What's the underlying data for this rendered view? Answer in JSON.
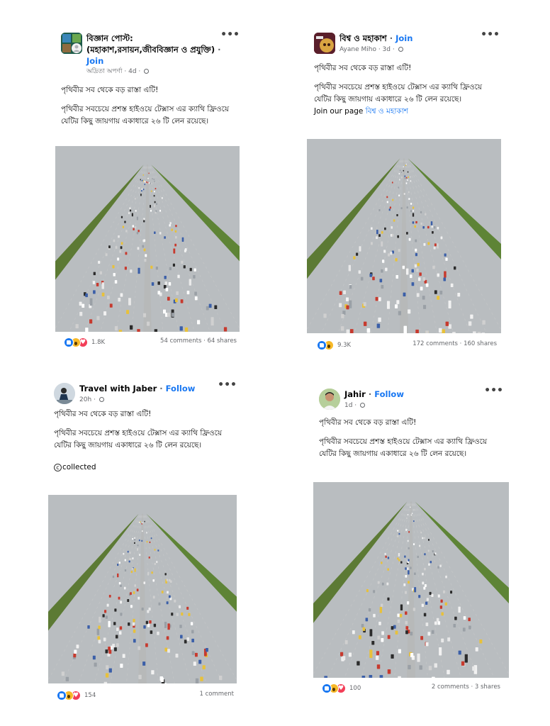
{
  "posts": [
    {
      "page_name": "বিজ্ঞান পোস্ট: (মহাকাশ,রসায়ন,জীববিজ্ঞান ও প্রযুক্তি)",
      "action": "Join",
      "meta": "অদ্রিতা অপর্ণা · 4d ·",
      "line1": "পৃথিবীর সব থেকে বড় রাস্তা এটি!",
      "line2": "পৃথিবীর সবচেয়ে প্রশস্ত হাইওয়ে টেক্সাস এর ক্যাথি ফ্রিওয়ে যেটির কিছু জায়গায় একাধারে ২৬ টি লেন রয়েছে।",
      "reaction_count": "1.8K",
      "stats": "54 comments · 64 shares",
      "reactions": [
        "like-icon",
        "wow-icon",
        "love-icon"
      ]
    },
    {
      "page_name": "বিশ্ব ও মহাকাশ",
      "action": "Join",
      "meta": "Ayane Miho · 3d ·",
      "line1": "পৃথিবীর সব থেকে বড় রাস্তা এটি!",
      "line2": "পৃথিবীর সবচেয়ে প্রশস্ত হাইওয়ে টেক্সাস এর ক্যাথি ফ্রিওয়ে যেটির কিছু জায়গায় একাধারে ২৬ টি লেন রয়েছে।",
      "join_text": "Join our page",
      "join_link": "বিশ্ব ও মহাকাশ",
      "reaction_count": "9.3K",
      "stats": "172 comments · 160 shares",
      "reactions": [
        "like-icon",
        "wow-icon"
      ]
    },
    {
      "page_name": "Travel with Jaber",
      "action": "Follow",
      "meta": "20h ·",
      "line1": "পৃথিবীর সব থেকে বড় রাস্তা এটি!",
      "line2": "পৃথিবীর সবচেয়ে প্রশস্ত হাইওয়ে টেক্সাস এর ক্যাথি ফ্রিওয়ে যেটির কিছু জায়গায় একাধারে ২৬ টি লেন রয়েছে।",
      "collected_symbol": "c",
      "collected": "collected",
      "reaction_count": "154",
      "stats": "1 comment",
      "reactions": [
        "like-icon",
        "wow-icon",
        "love-icon"
      ]
    },
    {
      "page_name": "Jahir",
      "action": "Follow",
      "meta": "1d ·",
      "line1": "পৃথিবীর সব থেকে বড় রাস্তা এটি!",
      "line2": "পৃথিবীর সবচেয়ে প্রশস্ত হাইওয়ে টেক্সাস এর ক্যাথি ফ্রিওয়ে যেটির কিছু জায়গায় একাধারে ২৬ টি লেন রয়েছে।",
      "reaction_count": "100",
      "stats": "2 comments · 3 shares",
      "reactions": [
        "like-icon",
        "wow-icon",
        "love-icon"
      ]
    }
  ],
  "more_glyph": "•••",
  "dot_separator": "·",
  "colors": {
    "link_blue": "#1877f2",
    "like_blue": "#1877f2",
    "wow_yellow": "#f7b928",
    "love_red": "#f33e58",
    "meta_gray": "#65676b"
  }
}
